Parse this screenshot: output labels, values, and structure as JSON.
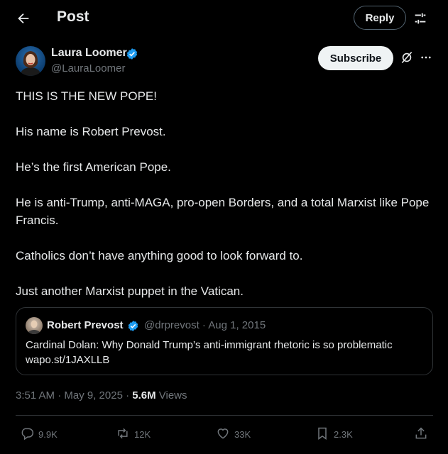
{
  "header": {
    "title": "Post",
    "reply_label": "Reply"
  },
  "author": {
    "name": "Laura Loomer",
    "handle": "@LauraLoomer",
    "subscribe_label": "Subscribe"
  },
  "post": {
    "lines": [
      "THIS IS THE NEW POPE!",
      "His name is Robert Prevost.",
      "He’s the first American Pope.",
      "He is anti-Trump, anti-MAGA, pro-open Borders, and a total Marxist like Pope Francis.",
      "Catholics don’t have anything good to look forward to.",
      "Just another Marxist puppet in the Vatican."
    ]
  },
  "quote": {
    "name": "Robert Prevost",
    "meta": "@drprevost · Aug 1, 2015",
    "text_line1": "Cardinal Dolan: Why Donald Trump’s anti-immigrant rhetoric is so problematic",
    "text_line2": "wapo.st/1JAXLLB"
  },
  "meta": {
    "time": "3:51 AM · May 9, 2025 · ",
    "views_count": "5.6M",
    "views_label": " Views"
  },
  "actions": {
    "replies": "9.9K",
    "reposts": "12K",
    "likes": "33K",
    "bookmarks": "2.3K"
  },
  "colors": {
    "background": "#000000",
    "text": "#e7e9ea",
    "muted": "#71767b",
    "verified": "#1d9bf0",
    "border": "#2f3336"
  },
  "icons": [
    "back-arrow-icon",
    "filter-icon",
    "verified-icon",
    "grok-icon",
    "more-icon",
    "reply-icon",
    "repost-icon",
    "like-icon",
    "bookmark-icon",
    "share-icon"
  ]
}
